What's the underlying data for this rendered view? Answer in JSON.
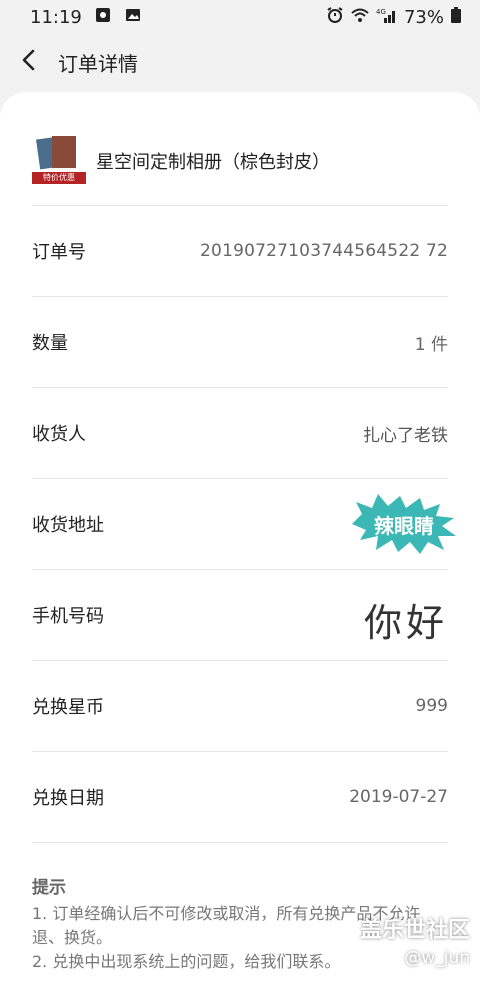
{
  "status": {
    "time": "11:19",
    "battery": "73%",
    "network": "4G"
  },
  "header": {
    "title": "订单详情"
  },
  "product": {
    "name": "星空间定制相册（棕色封皮）",
    "tag": "特价优惠"
  },
  "rows": [
    {
      "label": "订单号",
      "value": "20190727103744564522 72"
    },
    {
      "label": "数量",
      "value": "1 件"
    },
    {
      "label": "收货人",
      "value": "扎心了老铁"
    },
    {
      "label": "收货地址",
      "value": ""
    },
    {
      "label": "手机号码",
      "value": ""
    },
    {
      "label": "兑换星币",
      "value": "999"
    },
    {
      "label": "兑换日期",
      "value": "2019-07-27"
    }
  ],
  "notes": {
    "title": "提示",
    "line1": "1. 订单经确认后不可修改或取消，所有兑换产品不允许退、换货。",
    "line2": "2. 兑换中出现系统上的问题，给我们联系。"
  },
  "overlays": {
    "sticker_text": "辣眼睛",
    "handwriting": "你好"
  },
  "watermark": {
    "line1": "盖乐世社区",
    "line2": "@w_jun"
  },
  "colors": {
    "sticker": "#3bb8b5",
    "tag_bg": "#b52424"
  }
}
